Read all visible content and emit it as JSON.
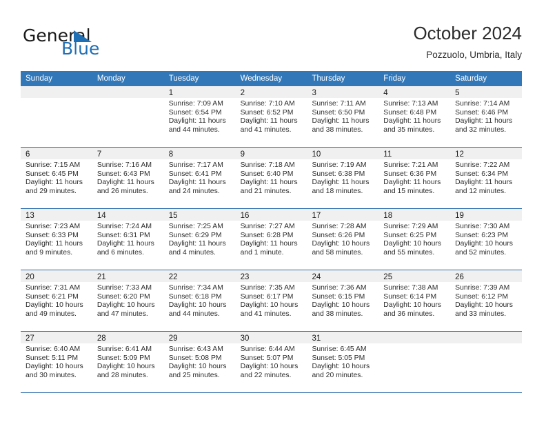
{
  "brand": {
    "name_part1": "General",
    "name_part2": "Blue",
    "accent_color": "#1f6fb5"
  },
  "header": {
    "month_title": "October 2024",
    "location": "Pozzuolo, Umbria, Italy"
  },
  "theme": {
    "header_bar_color": "#3278b9",
    "row_divider_color": "#2b6cab",
    "daynum_band_color": "#f0f0f0"
  },
  "weekdays": [
    "Sunday",
    "Monday",
    "Tuesday",
    "Wednesday",
    "Thursday",
    "Friday",
    "Saturday"
  ],
  "weeks": [
    [
      {
        "day": "",
        "lines": []
      },
      {
        "day": "",
        "lines": []
      },
      {
        "day": "1",
        "lines": [
          "Sunrise: 7:09 AM",
          "Sunset: 6:54 PM",
          "Daylight: 11 hours",
          "and 44 minutes."
        ]
      },
      {
        "day": "2",
        "lines": [
          "Sunrise: 7:10 AM",
          "Sunset: 6:52 PM",
          "Daylight: 11 hours",
          "and 41 minutes."
        ]
      },
      {
        "day": "3",
        "lines": [
          "Sunrise: 7:11 AM",
          "Sunset: 6:50 PM",
          "Daylight: 11 hours",
          "and 38 minutes."
        ]
      },
      {
        "day": "4",
        "lines": [
          "Sunrise: 7:13 AM",
          "Sunset: 6:48 PM",
          "Daylight: 11 hours",
          "and 35 minutes."
        ]
      },
      {
        "day": "5",
        "lines": [
          "Sunrise: 7:14 AM",
          "Sunset: 6:46 PM",
          "Daylight: 11 hours",
          "and 32 minutes."
        ]
      }
    ],
    [
      {
        "day": "6",
        "lines": [
          "Sunrise: 7:15 AM",
          "Sunset: 6:45 PM",
          "Daylight: 11 hours",
          "and 29 minutes."
        ]
      },
      {
        "day": "7",
        "lines": [
          "Sunrise: 7:16 AM",
          "Sunset: 6:43 PM",
          "Daylight: 11 hours",
          "and 26 minutes."
        ]
      },
      {
        "day": "8",
        "lines": [
          "Sunrise: 7:17 AM",
          "Sunset: 6:41 PM",
          "Daylight: 11 hours",
          "and 24 minutes."
        ]
      },
      {
        "day": "9",
        "lines": [
          "Sunrise: 7:18 AM",
          "Sunset: 6:40 PM",
          "Daylight: 11 hours",
          "and 21 minutes."
        ]
      },
      {
        "day": "10",
        "lines": [
          "Sunrise: 7:19 AM",
          "Sunset: 6:38 PM",
          "Daylight: 11 hours",
          "and 18 minutes."
        ]
      },
      {
        "day": "11",
        "lines": [
          "Sunrise: 7:21 AM",
          "Sunset: 6:36 PM",
          "Daylight: 11 hours",
          "and 15 minutes."
        ]
      },
      {
        "day": "12",
        "lines": [
          "Sunrise: 7:22 AM",
          "Sunset: 6:34 PM",
          "Daylight: 11 hours",
          "and 12 minutes."
        ]
      }
    ],
    [
      {
        "day": "13",
        "lines": [
          "Sunrise: 7:23 AM",
          "Sunset: 6:33 PM",
          "Daylight: 11 hours",
          "and 9 minutes."
        ]
      },
      {
        "day": "14",
        "lines": [
          "Sunrise: 7:24 AM",
          "Sunset: 6:31 PM",
          "Daylight: 11 hours",
          "and 6 minutes."
        ]
      },
      {
        "day": "15",
        "lines": [
          "Sunrise: 7:25 AM",
          "Sunset: 6:29 PM",
          "Daylight: 11 hours",
          "and 4 minutes."
        ]
      },
      {
        "day": "16",
        "lines": [
          "Sunrise: 7:27 AM",
          "Sunset: 6:28 PM",
          "Daylight: 11 hours",
          "and 1 minute."
        ]
      },
      {
        "day": "17",
        "lines": [
          "Sunrise: 7:28 AM",
          "Sunset: 6:26 PM",
          "Daylight: 10 hours",
          "and 58 minutes."
        ]
      },
      {
        "day": "18",
        "lines": [
          "Sunrise: 7:29 AM",
          "Sunset: 6:25 PM",
          "Daylight: 10 hours",
          "and 55 minutes."
        ]
      },
      {
        "day": "19",
        "lines": [
          "Sunrise: 7:30 AM",
          "Sunset: 6:23 PM",
          "Daylight: 10 hours",
          "and 52 minutes."
        ]
      }
    ],
    [
      {
        "day": "20",
        "lines": [
          "Sunrise: 7:31 AM",
          "Sunset: 6:21 PM",
          "Daylight: 10 hours",
          "and 49 minutes."
        ]
      },
      {
        "day": "21",
        "lines": [
          "Sunrise: 7:33 AM",
          "Sunset: 6:20 PM",
          "Daylight: 10 hours",
          "and 47 minutes."
        ]
      },
      {
        "day": "22",
        "lines": [
          "Sunrise: 7:34 AM",
          "Sunset: 6:18 PM",
          "Daylight: 10 hours",
          "and 44 minutes."
        ]
      },
      {
        "day": "23",
        "lines": [
          "Sunrise: 7:35 AM",
          "Sunset: 6:17 PM",
          "Daylight: 10 hours",
          "and 41 minutes."
        ]
      },
      {
        "day": "24",
        "lines": [
          "Sunrise: 7:36 AM",
          "Sunset: 6:15 PM",
          "Daylight: 10 hours",
          "and 38 minutes."
        ]
      },
      {
        "day": "25",
        "lines": [
          "Sunrise: 7:38 AM",
          "Sunset: 6:14 PM",
          "Daylight: 10 hours",
          "and 36 minutes."
        ]
      },
      {
        "day": "26",
        "lines": [
          "Sunrise: 7:39 AM",
          "Sunset: 6:12 PM",
          "Daylight: 10 hours",
          "and 33 minutes."
        ]
      }
    ],
    [
      {
        "day": "27",
        "lines": [
          "Sunrise: 6:40 AM",
          "Sunset: 5:11 PM",
          "Daylight: 10 hours",
          "and 30 minutes."
        ]
      },
      {
        "day": "28",
        "lines": [
          "Sunrise: 6:41 AM",
          "Sunset: 5:09 PM",
          "Daylight: 10 hours",
          "and 28 minutes."
        ]
      },
      {
        "day": "29",
        "lines": [
          "Sunrise: 6:43 AM",
          "Sunset: 5:08 PM",
          "Daylight: 10 hours",
          "and 25 minutes."
        ]
      },
      {
        "day": "30",
        "lines": [
          "Sunrise: 6:44 AM",
          "Sunset: 5:07 PM",
          "Daylight: 10 hours",
          "and 22 minutes."
        ]
      },
      {
        "day": "31",
        "lines": [
          "Sunrise: 6:45 AM",
          "Sunset: 5:05 PM",
          "Daylight: 10 hours",
          "and 20 minutes."
        ]
      },
      {
        "day": "",
        "lines": []
      },
      {
        "day": "",
        "lines": []
      }
    ]
  ]
}
